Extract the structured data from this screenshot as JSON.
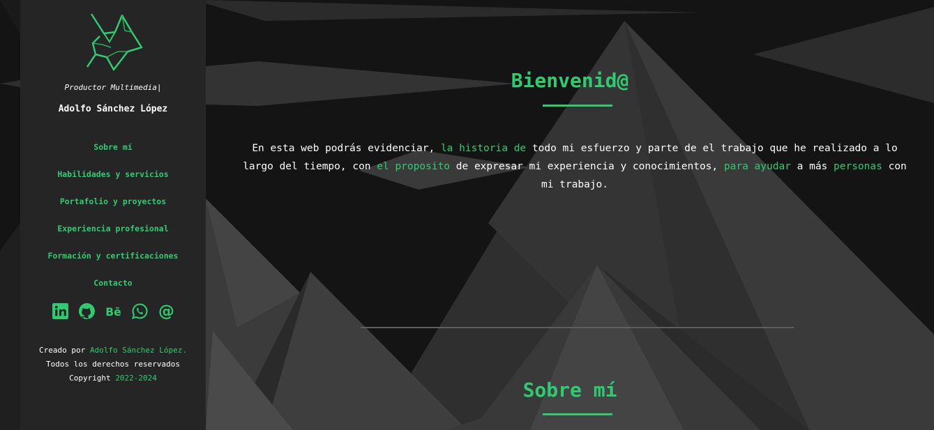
{
  "sidebar": {
    "logo_icon": "wolf-logo-icon",
    "role": "Productor Multimedia|",
    "name": "Adolfo Sánchez López",
    "nav": [
      {
        "label": "Sobre mí"
      },
      {
        "label": "Habilidades y servicios"
      },
      {
        "label": "Portafolio y proyectos"
      },
      {
        "label": "Experiencia profesional"
      },
      {
        "label": "Formación y certificaciones"
      },
      {
        "label": "Contacto"
      }
    ],
    "socials": [
      "linkedin-icon",
      "github-icon",
      "behance-icon",
      "whatsapp-icon",
      "email-at-icon"
    ],
    "credits": {
      "created_prefix": "Creado por ",
      "author": "Adolfo Sánchez López.",
      "rights": "Todos los derechos reservados",
      "copyright_prefix": "Copyright ",
      "years": "2022-2024"
    }
  },
  "main": {
    "welcome": {
      "title": "Bienvenid@",
      "text": {
        "p1": "En esta web podrás evidenciar, ",
        "h1": "la historia de",
        "p2": " todo mi esfuerzo y parte de el trabajo que he realizado a lo largo del tiempo, con ",
        "h2": "el proposito",
        "p3": " de expresar mi experiencia y conocimientos, ",
        "h3": "para ayudar",
        "p4": " a más ",
        "h4": "personas",
        "p5": " con mi trabajo."
      }
    },
    "about": {
      "title": "Sobre mí"
    }
  },
  "colors": {
    "accent": "#2ecc71",
    "sidebar_bg": "#252525",
    "page_bg": "#151515"
  }
}
